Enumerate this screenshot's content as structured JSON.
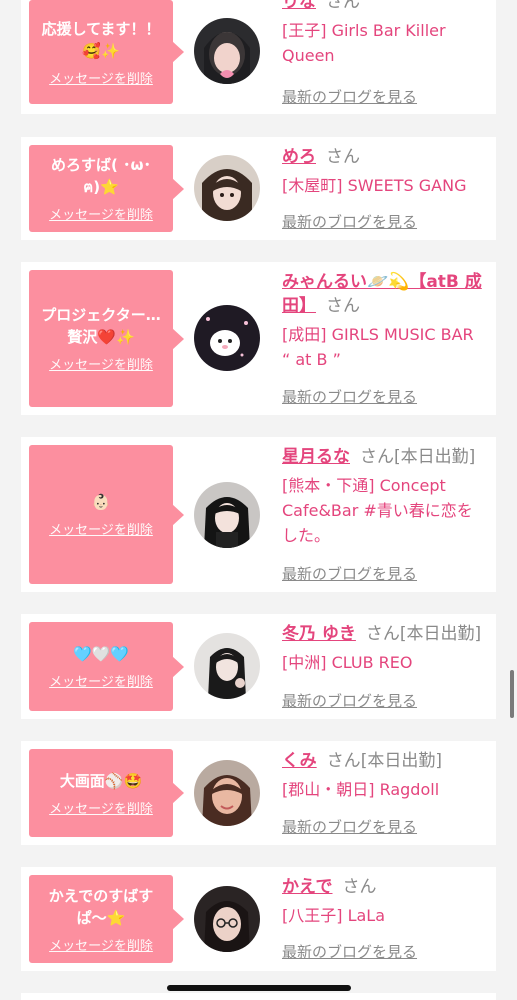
{
  "items": [
    {
      "message": "応援してます！！\n🥰✨",
      "delete_label": "メッセージを削除",
      "name": "りな",
      "honorific": "さん",
      "status": "",
      "shop": "[王子] Girls Bar Killer\nQueen",
      "blog_label": "最新のブログを見る"
    },
    {
      "message": "めろすば( ･ω･ฅ)⭐",
      "delete_label": "メッセージを削除",
      "name": "めろ",
      "honorific": "さん",
      "status": "",
      "shop": "[木屋町] SWEETS GANG",
      "blog_label": "最新のブログを見る"
    },
    {
      "message": "プロジェクター…\n贅沢❤️✨",
      "delete_label": "メッセージを削除",
      "name": "みゃんるい🪐💫【atB 成田】",
      "honorific": "さん",
      "status": "",
      "shop": "[成田] GIRLS MUSIC BAR\n“ at B ”",
      "blog_label": "最新のブログを見る"
    },
    {
      "message": "👶🏻",
      "delete_label": "メッセージを削除",
      "name": "星月るな",
      "honorific": "さん",
      "status": "[本日出勤]",
      "shop": "[熊本・下通] Concept\nCafe&Bar #青い春に恋を\nした。",
      "blog_label": "最新のブログを見る"
    },
    {
      "message": "🩵🤍🩵",
      "delete_label": "メッセージを削除",
      "name": "冬乃 ゆき",
      "honorific": "さん",
      "status": "[本日出勤]",
      "shop": "[中洲] CLUB REO",
      "blog_label": "最新のブログを見る"
    },
    {
      "message": "大画面⚾🤩",
      "delete_label": "メッセージを削除",
      "name": "くみ",
      "honorific": "さん",
      "status": "[本日出勤]",
      "shop": "[郡山・朝日] Ragdoll",
      "blog_label": "最新のブログを見る"
    },
    {
      "message": "かえでのすばす\nぱ〜⭐",
      "delete_label": "メッセージを削除",
      "name": "かえで",
      "honorific": "さん",
      "status": "",
      "shop": "[八王子] LaLa",
      "blog_label": "最新のブログを見る"
    }
  ],
  "colors": {
    "accent": "#e4457d",
    "bubble": "#fc8f9f",
    "muted": "#8a8a8a",
    "background": "#f3f3f3"
  }
}
